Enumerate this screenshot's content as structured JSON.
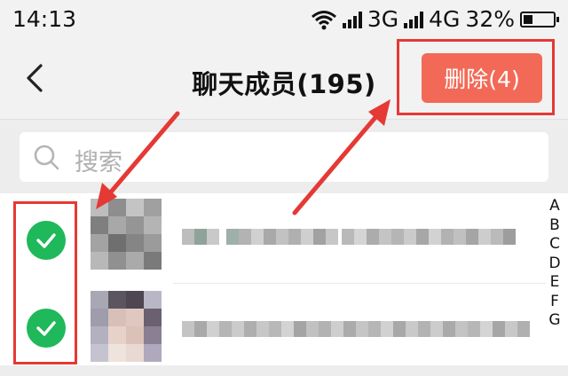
{
  "status_bar": {
    "time": "14:13",
    "net1": "3G",
    "net2": "4G",
    "battery": "32%",
    "battery_level": 0.32,
    "icons": [
      "wifi-icon",
      "signal-icon",
      "signal-icon",
      "battery-icon"
    ]
  },
  "header": {
    "title": "聊天成员(195)",
    "back_icon": "chevron-left-icon",
    "delete_label": "删除(4)",
    "delete_color": "#f26a57"
  },
  "search": {
    "placeholder": "搜索",
    "icon": "search-icon"
  },
  "members": [
    {
      "selected": true,
      "name_redacted": true
    },
    {
      "selected": true,
      "name_redacted": true
    }
  ],
  "index_letters": [
    "A",
    "B",
    "C",
    "D",
    "E",
    "F",
    "G"
  ],
  "colors": {
    "check_green": "#1fb85a",
    "annotation_red": "#e53935"
  }
}
